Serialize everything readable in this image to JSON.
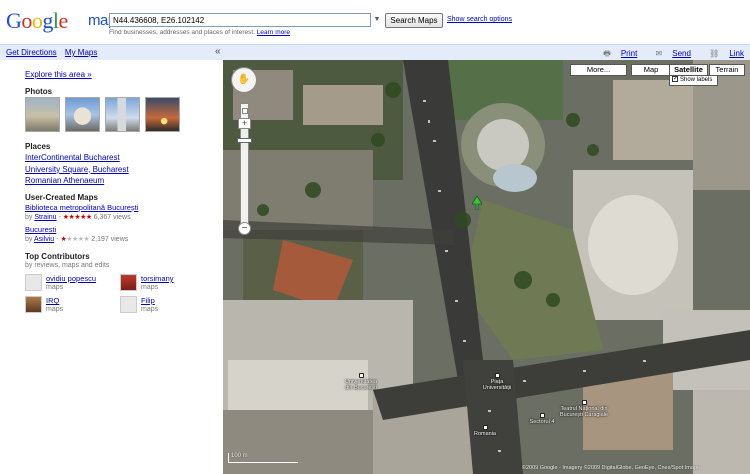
{
  "header": {
    "search_value": "N44.436608, E26.102142",
    "search_button": "Search Maps",
    "show_options": "Show search options",
    "hint_text": "Find businesses, addresses and places of interest.",
    "hint_link": "Learn more"
  },
  "toolbar": {
    "get_directions": "Get Directions",
    "my_maps": "My Maps",
    "collapse": "«",
    "print": "Print",
    "send": "Send",
    "link": "Link"
  },
  "sidebar": {
    "explore": "Explore this area »",
    "photos_title": "Photos",
    "places_title": "Places",
    "places": [
      "InterContinental Bucharest",
      "University Square, Bucharest",
      "Romanian Athenaeum"
    ],
    "ucm_title": "User-Created Maps",
    "maps": [
      {
        "name": "Biblioteca metropolitană București",
        "by": "by",
        "author": "Strainu",
        "stars_on": "★★★★★",
        "stars_off": "",
        "views": "6,367 views"
      },
      {
        "name": "Bucuresti",
        "by": "by",
        "author": "Asilviu",
        "stars_on": "★",
        "stars_off": "★★★★",
        "views": "2,197 views"
      }
    ],
    "contributors_title": "Top Contributors",
    "contributors_sub": "by reviews, maps and edits",
    "contributors": [
      {
        "name": "ovidiu popescu",
        "meta": "maps"
      },
      {
        "name": "torsimany",
        "meta": "maps"
      },
      {
        "name": "IRQ",
        "meta": "maps"
      },
      {
        "name": "Filip",
        "meta": "maps"
      }
    ]
  },
  "map": {
    "more_button": "More...",
    "map_button": "Map",
    "satellite_button": "Satellite",
    "terrain_button": "Terrain",
    "show_labels": "Show labels",
    "labels": [
      {
        "text": "Universitatea din București"
      },
      {
        "text": "Piața Universității"
      },
      {
        "text": "Teatrul Național din București Caragiale"
      },
      {
        "text": "Sectorul 4"
      },
      {
        "text": "Romania"
      }
    ],
    "scale": "100 m",
    "copyright": "©2009 Google · Imagery ©2009 DigitalGlobe, GeoEye, Cnes/Spot Image"
  }
}
